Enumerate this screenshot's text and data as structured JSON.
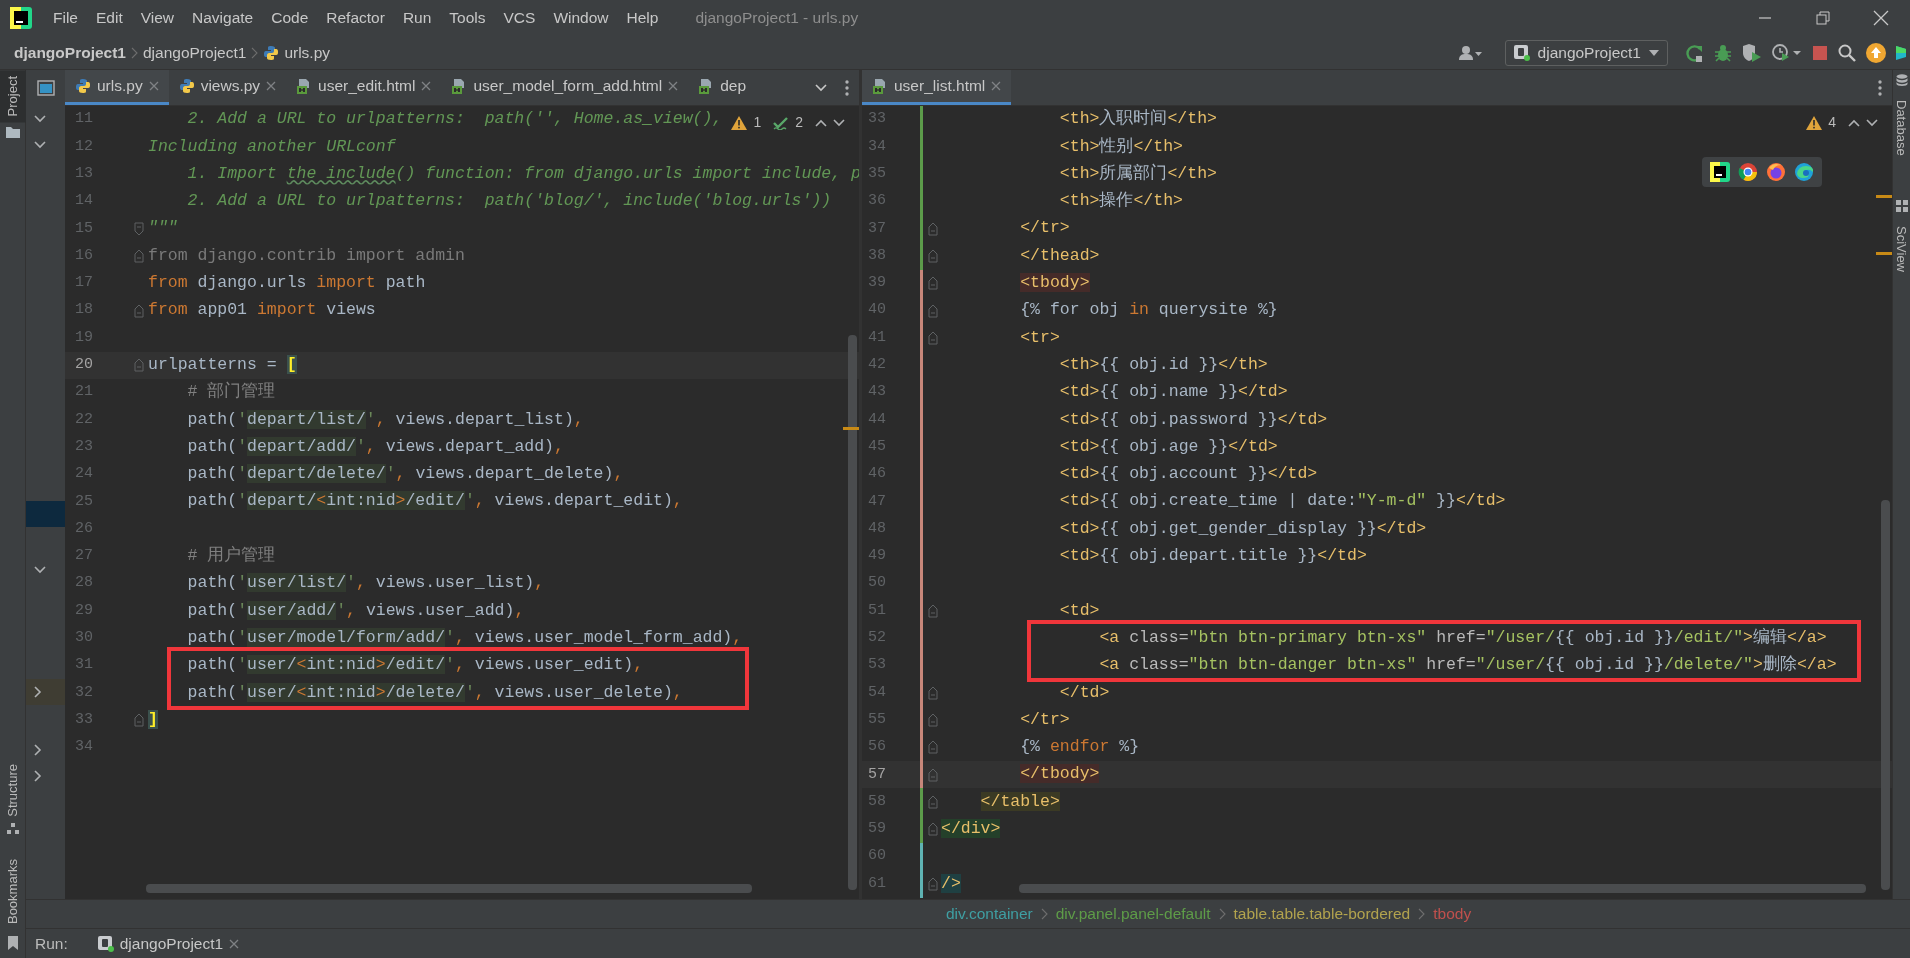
{
  "window": {
    "title": "djangoProject1 - urls.py"
  },
  "menu": [
    "File",
    "Edit",
    "View",
    "Navigate",
    "Code",
    "Refactor",
    "Run",
    "Tools",
    "VCS",
    "Window",
    "Help"
  ],
  "navigation_bar": {
    "breadcrumbs": [
      {
        "text": "djangoProject1",
        "kind": "project"
      },
      {
        "text": "djangoProject1",
        "kind": "folder"
      },
      {
        "text": "urls.py",
        "kind": "python"
      }
    ],
    "run_configuration": "djangoProject1"
  },
  "tool_windows": {
    "left": [
      {
        "label": "Project",
        "selected": true
      },
      {
        "label": "Structure",
        "selected": false
      },
      {
        "label": "Bookmarks",
        "selected": false
      }
    ],
    "right": [
      {
        "label": "Database"
      },
      {
        "label": "SciView"
      }
    ]
  },
  "editors": [
    {
      "kind": "python",
      "tabs": [
        {
          "label": "urls.py",
          "kind": "python",
          "selected": true
        },
        {
          "label": "views.py",
          "kind": "python",
          "selected": false
        },
        {
          "label": "user_edit.html",
          "kind": "html",
          "selected": false
        },
        {
          "label": "user_model_form_add.html",
          "kind": "html",
          "selected": false
        },
        {
          "label": "dep",
          "kind": "html",
          "selected": false
        }
      ],
      "inspection": {
        "warnings": "1",
        "checks": "2"
      },
      "lines": [
        {
          "number": "11",
          "spans": [
            {
              "kind": "doc",
              "text": "    2. Add a URL to urlpatterns:  path('', Home.as_view(),"
            }
          ]
        },
        {
          "number": "12",
          "spans": [
            {
              "kind": "doc",
              "text": "Including another URLconf"
            }
          ]
        },
        {
          "number": "13",
          "spans": [
            {
              "kind": "doc",
              "text": "    1. Import "
            },
            {
              "kind": "typo",
              "text": "the include"
            },
            {
              "kind": "doc",
              "text": "() function: from django.urls import include, p"
            }
          ]
        },
        {
          "number": "14",
          "spans": [
            {
              "kind": "doc",
              "text": "    2. Add a URL to urlpatterns:  path('blog/', include('blog.urls'))"
            }
          ]
        },
        {
          "number": "15",
          "fold": true,
          "spans": [
            {
              "kind": "doc",
              "text": "\"\"\""
            }
          ]
        },
        {
          "number": "16",
          "fold": true,
          "spans": [
            {
              "kind": "unused",
              "text": "from django.contrib import admin"
            }
          ]
        },
        {
          "number": "17",
          "spans": [
            {
              "kind": "kw",
              "text": "from"
            },
            {
              "kind": "plain",
              "text": " django.urls "
            },
            {
              "kind": "kw",
              "text": "import"
            },
            {
              "kind": "plain",
              "text": " path"
            }
          ]
        },
        {
          "number": "18",
          "fold": true,
          "spans": [
            {
              "kind": "kw",
              "text": "from"
            },
            {
              "kind": "plain",
              "text": " app01 "
            },
            {
              "kind": "kw",
              "text": "import"
            },
            {
              "kind": "plain",
              "text": " views"
            }
          ]
        },
        {
          "number": "19"
        },
        {
          "number": "20",
          "fold": true,
          "current": true,
          "spans": [
            {
              "kind": "plain",
              "text": "urlpatterns = "
            },
            {
              "kind": "match",
              "text": "["
            }
          ]
        },
        {
          "number": "21",
          "spans": [
            {
              "kind": "comment",
              "text": "    # 部门管理"
            }
          ]
        },
        {
          "number": "22",
          "spans": [
            {
              "kind": "plain",
              "text": "    path("
            },
            {
              "kind": "str",
              "text": "'"
            },
            {
              "kind": "url",
              "text": "depart/list/"
            },
            {
              "kind": "str",
              "text": "'"
            },
            {
              "kind": "kw",
              "text": ","
            },
            {
              "kind": "plain",
              "text": " views.depart_list)"
            },
            {
              "kind": "kw",
              "text": ","
            }
          ]
        },
        {
          "number": "23",
          "spans": [
            {
              "kind": "plain",
              "text": "    path("
            },
            {
              "kind": "str",
              "text": "'"
            },
            {
              "kind": "url",
              "text": "depart/add/"
            },
            {
              "kind": "str",
              "text": "'"
            },
            {
              "kind": "kw",
              "text": ","
            },
            {
              "kind": "plain",
              "text": " views.depart_add)"
            },
            {
              "kind": "kw",
              "text": ","
            }
          ]
        },
        {
          "number": "24",
          "spans": [
            {
              "kind": "plain",
              "text": "    path("
            },
            {
              "kind": "str",
              "text": "'"
            },
            {
              "kind": "url",
              "text": "depart/delete/"
            },
            {
              "kind": "str",
              "text": "'"
            },
            {
              "kind": "kw",
              "text": ","
            },
            {
              "kind": "plain",
              "text": " views.depart_delete)"
            },
            {
              "kind": "kw",
              "text": ","
            }
          ]
        },
        {
          "number": "25",
          "spans": [
            {
              "kind": "plain",
              "text": "    path("
            },
            {
              "kind": "str",
              "text": "'"
            },
            {
              "kind": "url",
              "text": "depart/"
            },
            {
              "kind": "ub",
              "text": "<"
            },
            {
              "kind": "url",
              "text": "int:nid"
            },
            {
              "kind": "ub",
              "text": ">"
            },
            {
              "kind": "url",
              "text": "/edit/"
            },
            {
              "kind": "str",
              "text": "'"
            },
            {
              "kind": "kw",
              "text": ","
            },
            {
              "kind": "plain",
              "text": " views.depart_edit)"
            },
            {
              "kind": "kw",
              "text": ","
            }
          ]
        },
        {
          "number": "26"
        },
        {
          "number": "27",
          "spans": [
            {
              "kind": "comment",
              "text": "    # 用户管理"
            }
          ]
        },
        {
          "number": "28",
          "spans": [
            {
              "kind": "plain",
              "text": "    path("
            },
            {
              "kind": "str",
              "text": "'"
            },
            {
              "kind": "url",
              "text": "user/list/"
            },
            {
              "kind": "str",
              "text": "'"
            },
            {
              "kind": "kw",
              "text": ","
            },
            {
              "kind": "plain",
              "text": " views.user_list)"
            },
            {
              "kind": "kw",
              "text": ","
            }
          ]
        },
        {
          "number": "29",
          "spans": [
            {
              "kind": "plain",
              "text": "    path("
            },
            {
              "kind": "str",
              "text": "'"
            },
            {
              "kind": "url",
              "text": "user/add/"
            },
            {
              "kind": "str",
              "text": "'"
            },
            {
              "kind": "kw",
              "text": ","
            },
            {
              "kind": "plain",
              "text": " views.user_add)"
            },
            {
              "kind": "kw",
              "text": ","
            }
          ]
        },
        {
          "number": "30",
          "spans": [
            {
              "kind": "plain",
              "text": "    path("
            },
            {
              "kind": "str",
              "text": "'"
            },
            {
              "kind": "url",
              "text": "user/model/form/add/"
            },
            {
              "kind": "str",
              "text": "'"
            },
            {
              "kind": "kw",
              "text": ","
            },
            {
              "kind": "plain",
              "text": " views.user_model_form_add)"
            },
            {
              "kind": "kw",
              "text": ","
            }
          ]
        },
        {
          "number": "31",
          "boxed": true,
          "spans": [
            {
              "kind": "plain",
              "text": "    path("
            },
            {
              "kind": "str",
              "text": "'"
            },
            {
              "kind": "url",
              "text": "user/"
            },
            {
              "kind": "ub",
              "text": "<"
            },
            {
              "kind": "url",
              "text": "int:nid"
            },
            {
              "kind": "ub",
              "text": ">"
            },
            {
              "kind": "url",
              "text": "/edit/"
            },
            {
              "kind": "str",
              "text": "'"
            },
            {
              "kind": "kw",
              "text": ","
            },
            {
              "kind": "plain",
              "text": " views.user_edit)"
            },
            {
              "kind": "kw",
              "text": ","
            }
          ]
        },
        {
          "number": "32",
          "boxed": true,
          "spans": [
            {
              "kind": "plain",
              "text": "    path("
            },
            {
              "kind": "str",
              "text": "'"
            },
            {
              "kind": "url",
              "text": "user/"
            },
            {
              "kind": "ub",
              "text": "<"
            },
            {
              "kind": "url",
              "text": "int:nid"
            },
            {
              "kind": "ub",
              "text": ">"
            },
            {
              "kind": "url",
              "text": "/delete/"
            },
            {
              "kind": "str",
              "text": "'"
            },
            {
              "kind": "kw",
              "text": ","
            },
            {
              "kind": "plain",
              "text": " views.user_delete)"
            },
            {
              "kind": "kw",
              "text": ","
            }
          ]
        },
        {
          "number": "33",
          "fold": true,
          "spans": [
            {
              "kind": "match",
              "text": "]"
            }
          ]
        },
        {
          "number": "34"
        }
      ]
    },
    {
      "kind": "html",
      "tabs": [
        {
          "label": "user_list.html",
          "kind": "html",
          "selected": true
        }
      ],
      "inspection": {
        "warnings": "4"
      },
      "lines": [
        {
          "number": "33",
          "color": "#5c9b4a",
          "spans": [
            {
              "kind": "tag",
              "text": "            <th>"
            },
            {
              "kind": "plain",
              "text": "入职时间"
            },
            {
              "kind": "tag",
              "text": "</th>"
            }
          ]
        },
        {
          "number": "34",
          "color": "#5c9b4a",
          "spans": [
            {
              "kind": "tag",
              "text": "            <th>"
            },
            {
              "kind": "plain",
              "text": "性别"
            },
            {
              "kind": "tag",
              "text": "</th>"
            }
          ]
        },
        {
          "number": "35",
          "color": "#5c9b4a",
          "spans": [
            {
              "kind": "tag",
              "text": "            <th>"
            },
            {
              "kind": "plain",
              "text": "所属部门"
            },
            {
              "kind": "tag",
              "text": "</th>"
            }
          ]
        },
        {
          "number": "36",
          "color": "#5c9b4a",
          "spans": [
            {
              "kind": "tag",
              "text": "            <th>"
            },
            {
              "kind": "plain",
              "text": "操作"
            },
            {
              "kind": "tag",
              "text": "</th>"
            }
          ]
        },
        {
          "number": "37",
          "color": "#5c9b4a",
          "fold": true,
          "spans": [
            {
              "kind": "tag",
              "text": "        </tr>"
            }
          ]
        },
        {
          "number": "38",
          "color": "#5c9b4a",
          "fold": true,
          "spans": [
            {
              "kind": "tag",
              "text": "        </thead>"
            }
          ]
        },
        {
          "number": "39",
          "color": "#c7877a",
          "fold": true,
          "spans": [
            {
              "kind": "tagred",
              "text": "        <tbody>"
            }
          ]
        },
        {
          "number": "40",
          "color": "#c7877a",
          "fold": true,
          "spans": [
            {
              "kind": "plain",
              "text": "        {% for obj "
            },
            {
              "kind": "kw",
              "text": "in"
            },
            {
              "kind": "plain",
              "text": " querysite %}"
            }
          ]
        },
        {
          "number": "41",
          "color": "#c7877a",
          "fold": true,
          "spans": [
            {
              "kind": "tag",
              "text": "        <tr>"
            }
          ]
        },
        {
          "number": "42",
          "color": "#c7877a",
          "spans": [
            {
              "kind": "tag",
              "text": "            <th>"
            },
            {
              "kind": "plain",
              "text": "{{ obj.id }}"
            },
            {
              "kind": "tag",
              "text": "</th>"
            }
          ]
        },
        {
          "number": "43",
          "color": "#c7877a",
          "spans": [
            {
              "kind": "tag",
              "text": "            <td>"
            },
            {
              "kind": "plain",
              "text": "{{ obj.name }}"
            },
            {
              "kind": "tag",
              "text": "</td>"
            }
          ]
        },
        {
          "number": "44",
          "color": "#c7877a",
          "spans": [
            {
              "kind": "tag",
              "text": "            <td>"
            },
            {
              "kind": "plain",
              "text": "{{ obj.password }}"
            },
            {
              "kind": "tag",
              "text": "</td>"
            }
          ]
        },
        {
          "number": "45",
          "color": "#c7877a",
          "spans": [
            {
              "kind": "tag",
              "text": "            <td>"
            },
            {
              "kind": "plain",
              "text": "{{ obj.age }}"
            },
            {
              "kind": "tag",
              "text": "</td>"
            }
          ]
        },
        {
          "number": "46",
          "color": "#c7877a",
          "spans": [
            {
              "kind": "tag",
              "text": "            <td>"
            },
            {
              "kind": "plain",
              "text": "{{ obj.account }}"
            },
            {
              "kind": "tag",
              "text": "</td>"
            }
          ]
        },
        {
          "number": "47",
          "color": "#c7877a",
          "spans": [
            {
              "kind": "tag",
              "text": "            <td>"
            },
            {
              "kind": "plain",
              "text": "{{ obj.create_time | date:"
            },
            {
              "kind": "val",
              "text": "\"Y-m-d\""
            },
            {
              "kind": "plain",
              "text": " }}"
            },
            {
              "kind": "tag",
              "text": "</td>"
            }
          ]
        },
        {
          "number": "48",
          "color": "#c7877a",
          "spans": [
            {
              "kind": "tag",
              "text": "            <td>"
            },
            {
              "kind": "plain",
              "text": "{{ obj.get_gender_display }}"
            },
            {
              "kind": "tag",
              "text": "</td>"
            }
          ]
        },
        {
          "number": "49",
          "color": "#c7877a",
          "spans": [
            {
              "kind": "tag",
              "text": "            <td>"
            },
            {
              "kind": "plain",
              "text": "{{ obj.depart.title }}"
            },
            {
              "kind": "tag",
              "text": "</td>"
            }
          ]
        },
        {
          "number": "50",
          "color": "#c7877a"
        },
        {
          "number": "51",
          "color": "#c7877a",
          "fold": true,
          "spans": [
            {
              "kind": "tag",
              "text": "            <td>"
            }
          ]
        },
        {
          "number": "52",
          "color": "#c7877a",
          "boxed": true,
          "spans": [
            {
              "kind": "tag",
              "text": "                <a"
            },
            {
              "kind": "attr",
              "text": " class="
            },
            {
              "kind": "val",
              "text": "\"btn btn-primary btn-xs\""
            },
            {
              "kind": "attr",
              "text": " href="
            },
            {
              "kind": "val",
              "text": "\"/user/"
            },
            {
              "kind": "plain",
              "text": "{{ obj.id }}"
            },
            {
              "kind": "val",
              "text": "/edit/\""
            },
            {
              "kind": "tag",
              "text": ">"
            },
            {
              "kind": "plain",
              "text": "编辑"
            },
            {
              "kind": "tag",
              "text": "</a>"
            }
          ]
        },
        {
          "number": "53",
          "color": "#c7877a",
          "boxed": true,
          "spans": [
            {
              "kind": "tag",
              "text": "                <a"
            },
            {
              "kind": "attr",
              "text": " class="
            },
            {
              "kind": "val",
              "text": "\"btn btn-danger btn-xs\""
            },
            {
              "kind": "attr",
              "text": " href="
            },
            {
              "kind": "val",
              "text": "\"/user/"
            },
            {
              "kind": "plain",
              "text": "{{ obj.id }}"
            },
            {
              "kind": "val",
              "text": "/delete/\""
            },
            {
              "kind": "tag",
              "text": ">"
            },
            {
              "kind": "plain",
              "text": "删除"
            },
            {
              "kind": "tag",
              "text": "</a>"
            }
          ]
        },
        {
          "number": "54",
          "color": "#c7877a",
          "fold": true,
          "spans": [
            {
              "kind": "tag",
              "text": "            </td>"
            }
          ]
        },
        {
          "number": "55",
          "color": "#c7877a",
          "fold": true,
          "spans": [
            {
              "kind": "tag",
              "text": "        </tr>"
            }
          ]
        },
        {
          "number": "56",
          "color": "#c7877a",
          "fold": true,
          "spans": [
            {
              "kind": "plain",
              "text": "        {% "
            },
            {
              "kind": "kw",
              "text": "endfor"
            },
            {
              "kind": "plain",
              "text": " %}"
            }
          ]
        },
        {
          "number": "57",
          "color": "#c7877a",
          "fold": true,
          "current": true,
          "spans": [
            {
              "kind": "tagred",
              "text": "        </tbody>"
            }
          ]
        },
        {
          "number": "58",
          "color": "#5c9b4a",
          "fold": true,
          "spans": [
            {
              "kind": "tagolive",
              "text": "    </table>"
            }
          ]
        },
        {
          "number": "59",
          "color": "#5c9b4a",
          "fold": true,
          "spans": [
            {
              "kind": "taggreen",
              "text": "</div>"
            }
          ]
        },
        {
          "number": "60",
          "color": "#5fb3b3"
        },
        {
          "number": "61",
          "color": "#5fb3b3",
          "fold": true,
          "spans": [
            {
              "kind": "tagteal",
              "text": "/>"
            }
          ]
        }
      ],
      "breadcrumbs": [
        {
          "text": "div.container",
          "color": "#3f9fa3"
        },
        {
          "text": "div.panel.panel-default",
          "color": "#5e9c48"
        },
        {
          "text": "table.table.table-bordered",
          "color": "#b2a34e"
        },
        {
          "text": "tbody",
          "color": "#c0504d"
        }
      ]
    }
  ],
  "run_panel": {
    "label": "Run:",
    "tabs": [
      {
        "label": "djangoProject1"
      }
    ]
  }
}
